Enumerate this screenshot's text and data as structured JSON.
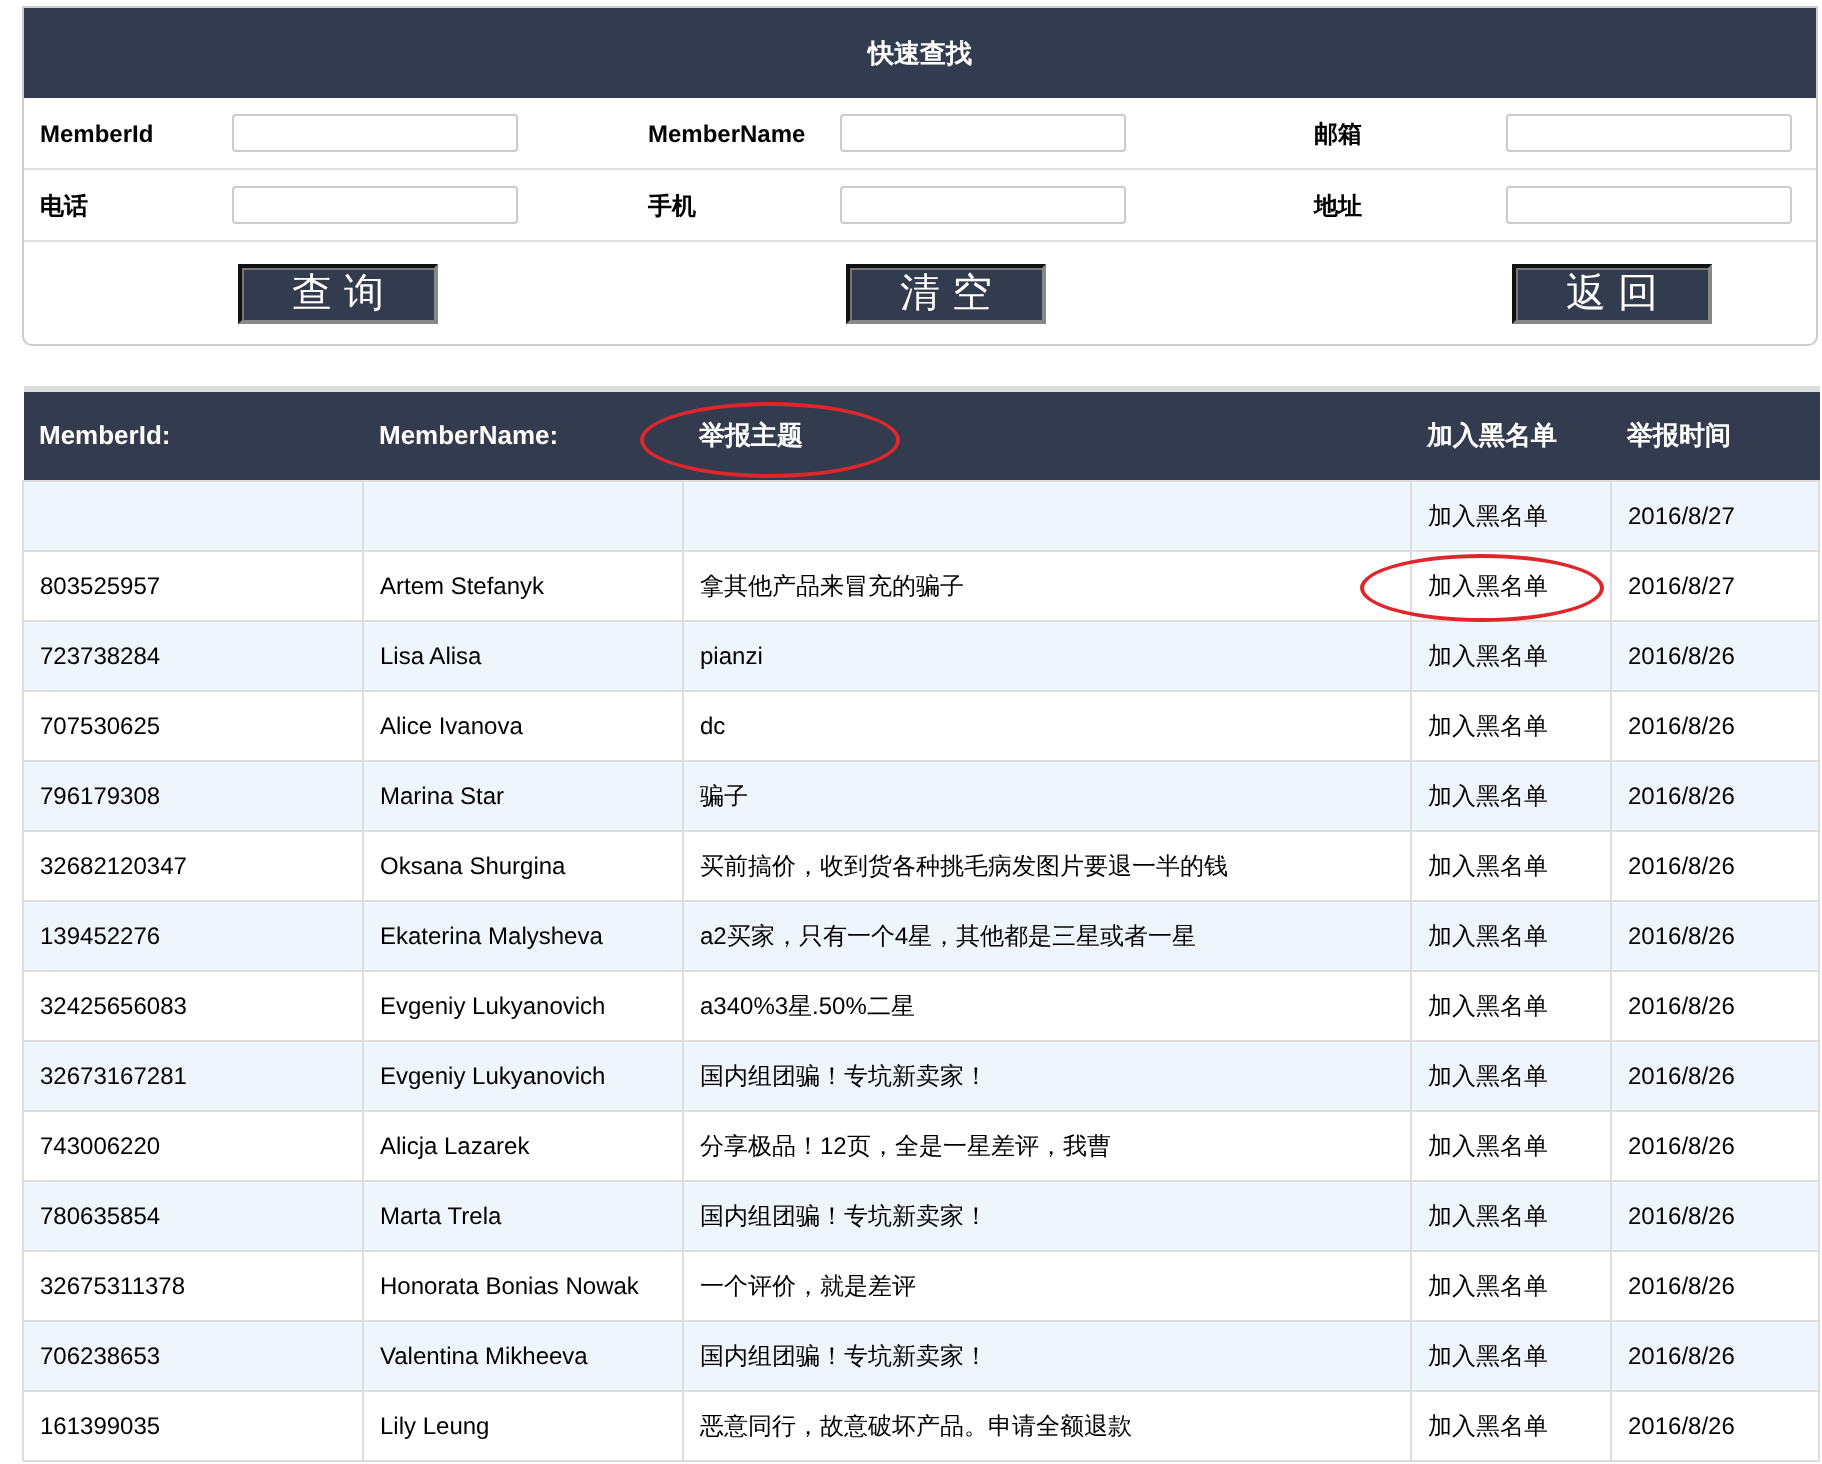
{
  "search_panel": {
    "title": "快速查找",
    "fields": [
      {
        "label": "MemberId"
      },
      {
        "label": "MemberName"
      },
      {
        "label": "邮箱"
      },
      {
        "label": "电话"
      },
      {
        "label": "手机"
      },
      {
        "label": "地址"
      }
    ],
    "buttons": [
      "查 询",
      "清 空",
      "返 回"
    ]
  },
  "table": {
    "columns": [
      {
        "label": "MemberId:",
        "circled": false
      },
      {
        "label": "MemberName:",
        "circled": false
      },
      {
        "label": "举报主题",
        "circled": true
      },
      {
        "label": "加入黑名单",
        "circled": false
      },
      {
        "label": "举报时间",
        "circled": false
      }
    ],
    "rows": [
      {
        "cells": [
          "",
          "",
          "",
          "加入黑名单",
          "2016/8/27"
        ],
        "circled": false
      },
      {
        "cells": [
          "803525957",
          "Artem Stefanyk",
          "拿其他产品来冒充的骗子",
          "加入黑名单",
          "2016/8/27"
        ],
        "circled": true
      },
      {
        "cells": [
          "723738284",
          "Lisa Alisa",
          "pianzi",
          "加入黑名单",
          "2016/8/26"
        ],
        "circled": false
      },
      {
        "cells": [
          "707530625",
          "Alice Ivanova",
          "dc",
          "加入黑名单",
          "2016/8/26"
        ],
        "circled": false
      },
      {
        "cells": [
          "796179308",
          "Marina Star",
          "骗子",
          "加入黑名单",
          "2016/8/26"
        ],
        "circled": false
      },
      {
        "cells": [
          "32682120347",
          "Oksana Shurgina",
          "买前搞价，收到货各种挑毛病发图片要退一半的钱",
          "加入黑名单",
          "2016/8/26"
        ],
        "circled": false
      },
      {
        "cells": [
          "139452276",
          "Ekaterina Malysheva",
          "a2买家，只有一个4星，其他都是三星或者一星",
          "加入黑名单",
          "2016/8/26"
        ],
        "circled": false
      },
      {
        "cells": [
          "32425656083",
          "Evgeniy Lukyanovich",
          "a340%3星.50%二星",
          "加入黑名单",
          "2016/8/26"
        ],
        "circled": false
      },
      {
        "cells": [
          "32673167281",
          "Evgeniy Lukyanovich",
          "国内组团骗！专坑新卖家！",
          "加入黑名单",
          "2016/8/26"
        ],
        "circled": false
      },
      {
        "cells": [
          "743006220",
          "Alicja Lazarek",
          "分享极品！12页，全是一星差评，我曹",
          "加入黑名单",
          "2016/8/26"
        ],
        "circled": false
      },
      {
        "cells": [
          "780635854",
          "Marta Trela",
          "国内组团骗！专坑新卖家！",
          "加入黑名单",
          "2016/8/26"
        ],
        "circled": false
      },
      {
        "cells": [
          "32675311378",
          "Honorata Bonias Nowak",
          "一个评价，就是差评",
          "加入黑名单",
          "2016/8/26"
        ],
        "circled": false
      },
      {
        "cells": [
          "706238653",
          "Valentina Mikheeva",
          "国内组团骗！专坑新卖家！",
          "加入黑名单",
          "2016/8/26"
        ],
        "circled": false
      },
      {
        "cells": [
          "161399035",
          "Lily Leung",
          "恶意同行，故意破坏产品。申请全额退款",
          "加入黑名单",
          "2016/8/26"
        ],
        "circled": false
      }
    ]
  }
}
